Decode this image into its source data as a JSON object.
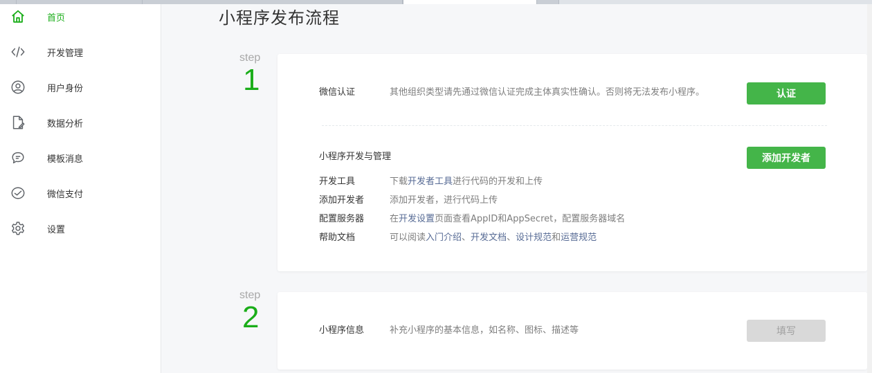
{
  "sidebar": {
    "items": [
      {
        "label": "首页",
        "icon": "home-icon",
        "active": true
      },
      {
        "label": "开发管理",
        "icon": "code-icon",
        "active": false
      },
      {
        "label": "用户身份",
        "icon": "user-icon",
        "active": false
      },
      {
        "label": "数据分析",
        "icon": "document-chart-icon",
        "active": false
      },
      {
        "label": "模板消息",
        "icon": "chat-bubble-icon",
        "active": false
      },
      {
        "label": "微信支付",
        "icon": "payment-icon",
        "active": false
      },
      {
        "label": "设置",
        "icon": "gear-icon",
        "active": false
      }
    ]
  },
  "page": {
    "title": "小程序发布流程"
  },
  "steps": [
    {
      "word": "step",
      "number": "1",
      "verify": {
        "label": "微信认证",
        "desc": "其他组织类型请先通过微信认证完成主体真实性确认。否则将无法发布小程序。",
        "button": "认证"
      },
      "dev": {
        "title": "小程序开发与管理",
        "button": "添加开发者",
        "rows": [
          {
            "label": "开发工具",
            "parts": [
              "下载",
              "开发者工具",
              "进行代码的开发和上传"
            ]
          },
          {
            "label": "添加开发者",
            "parts": [
              "添加开发者，进行代码上传"
            ]
          },
          {
            "label": "配置服务器",
            "parts": [
              "在",
              "开发设置",
              "页面查看AppID和AppSecret，配置服务器域名"
            ]
          },
          {
            "label": "帮助文档",
            "parts": [
              "可以阅读",
              "入门介绍",
              "、",
              "开发文档",
              "、",
              "设计规范",
              "和",
              "运营规范"
            ]
          }
        ]
      }
    },
    {
      "word": "step",
      "number": "2",
      "info": {
        "label": "小程序信息",
        "desc": "补充小程序的基本信息，如名称、图标、描述等",
        "button": "填写"
      }
    }
  ],
  "colors": {
    "accent": "#1aad19",
    "button": "#44b549",
    "link": "#576b95",
    "disabled": "#d9d9d9"
  }
}
